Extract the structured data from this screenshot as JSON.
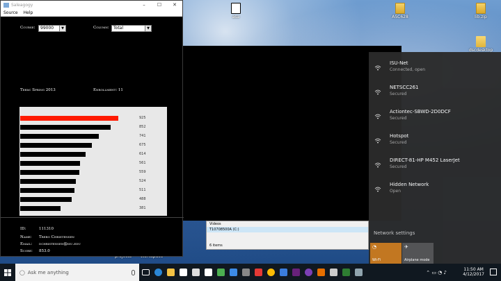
{
  "desktop": {
    "icons": [
      {
        "label": "asa",
        "kind": "dog"
      },
      {
        "label": "ASC628",
        "kind": "zip"
      },
      {
        "label": "lib.zip",
        "kind": "zip"
      },
      {
        "label": "dscdesktop",
        "kind": "folder"
      }
    ],
    "bottom_labels": [
      "projects",
      "Workspace"
    ]
  },
  "app": {
    "title": "Saleagogy",
    "menu": [
      "Source",
      "Help"
    ],
    "course_label": "Course:",
    "course_value": "99000",
    "column_label": "Column:",
    "column_value": "Total",
    "term_label": "Term: Spring 2013",
    "enrollment_label": "Enrollment: 11",
    "student": {
      "id_label": "ID:",
      "id_value": "111310",
      "name_label": "Name:",
      "name_value": "Trebo Christensen",
      "email_label": "Email:",
      "email_value": "dchristensen@isu.edu",
      "score_label": "Score:",
      "score_value": "853.0"
    }
  },
  "chart_data": {
    "type": "bar",
    "orientation": "horizontal",
    "values": [
      925,
      852,
      741,
      675,
      614,
      561,
      559,
      524,
      511,
      488,
      381
    ],
    "highlight_index": 0,
    "colors": {
      "highlight": "#ff1a00",
      "bar": "#000000",
      "background": "#e8e8e8"
    },
    "max": 925
  },
  "explorer": {
    "items": [
      "Videos",
      "T10708500A (C:)"
    ],
    "status": "6 items"
  },
  "wifi_panel": {
    "networks": [
      {
        "name": "ISU-Net",
        "status": "Connected, open"
      },
      {
        "name": "NETSCC261",
        "status": "Secured"
      },
      {
        "name": "Actiontec-SBWD-2D0DCF",
        "status": "Secured"
      },
      {
        "name": "Hotspot",
        "status": "Secured"
      },
      {
        "name": "DIRECT-81-HP M452 LaserJet",
        "status": "Secured"
      },
      {
        "name": "Hidden Network",
        "status": "Open"
      }
    ],
    "settings_link": "Network settings",
    "tiles": [
      {
        "label": "Wi-Fi",
        "color": "#c8791e",
        "active": true
      },
      {
        "label": "Airplane mode",
        "color": "#555555",
        "active": false
      }
    ]
  },
  "taskbar": {
    "search_placeholder": "Ask me anything",
    "time": "11:50 AM",
    "date": "4/12/2017"
  }
}
